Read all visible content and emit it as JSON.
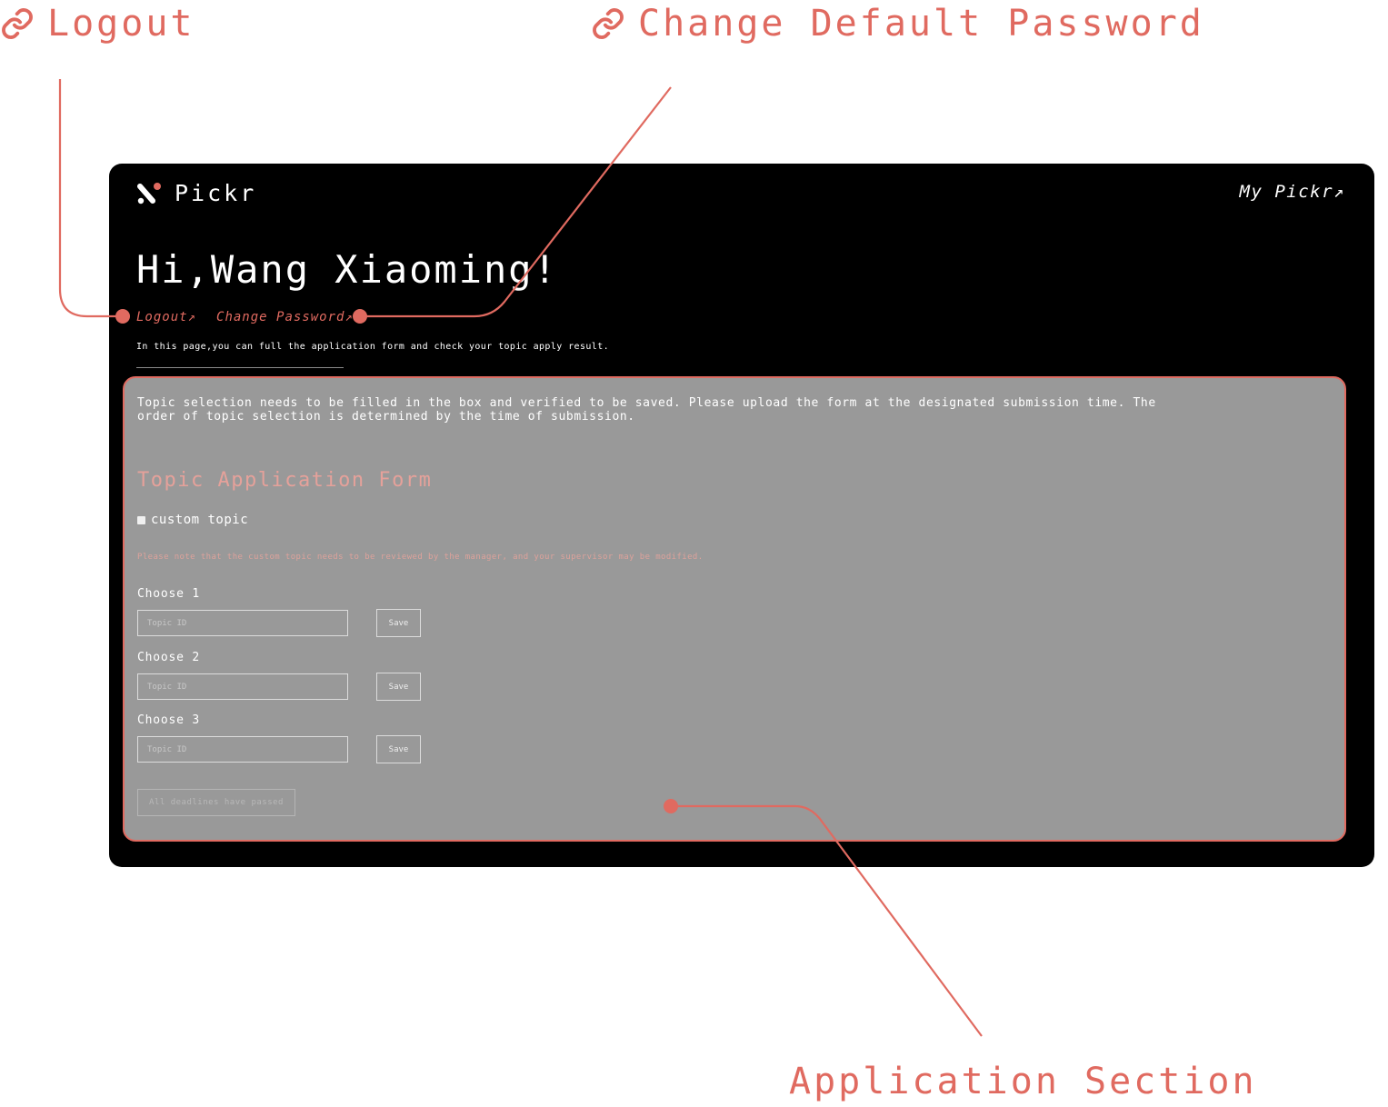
{
  "callouts": {
    "logout": "Logout",
    "change_password": "Change Default Password",
    "application": "Application Section"
  },
  "colors": {
    "accent": "#e06a60",
    "frame_bg": "#000000",
    "section_bg": "#999999",
    "form_title": "#e5a19a"
  },
  "header": {
    "brand": "Pickr",
    "my_pickr": "My Pickr↗"
  },
  "greeting": "Hi,Wang Xiaoming!",
  "user_links": {
    "logout": "Logout↗",
    "change_password": "Change Password↗"
  },
  "intro": "In this page,you can full the application form and check your topic apply result.",
  "application": {
    "notice": "Topic selection needs to be filled in the box and verified to be saved. Please upload the form at the designated submission time. The order of topic selection is determined by the time of submission.",
    "form_title": "Topic Application Form",
    "custom_topic_label": "custom topic",
    "custom_note": "Please note that the custom topic needs to be reviewed by the manager, and your supervisor may be modified.",
    "choices": [
      {
        "label": "Choose 1",
        "placeholder": "Topic ID",
        "save": "Save"
      },
      {
        "label": "Choose 2",
        "placeholder": "Topic ID",
        "save": "Save"
      },
      {
        "label": "Choose 3",
        "placeholder": "Topic ID",
        "save": "Save"
      }
    ],
    "deadline_button": "All deadlines have passed"
  },
  "icons": [
    "link-icon",
    "pickr-logo-icon"
  ]
}
